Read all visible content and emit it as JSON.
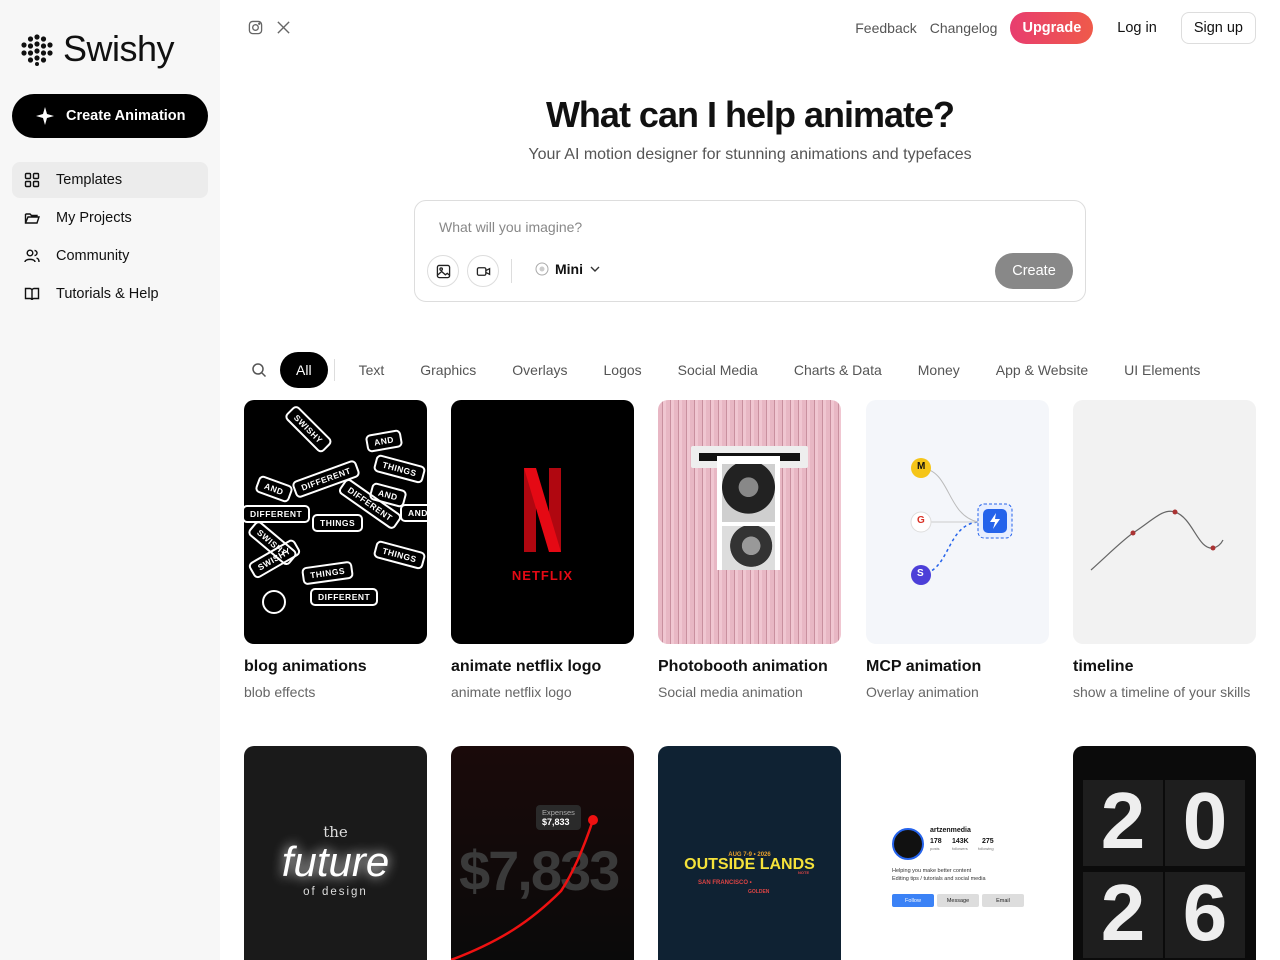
{
  "brand": {
    "name": "Swishy"
  },
  "sidebar": {
    "create_label": "Create Animation",
    "items": [
      {
        "label": "Templates",
        "icon": "grid-icon"
      },
      {
        "label": "My Projects",
        "icon": "folder-icon"
      },
      {
        "label": "Community",
        "icon": "users-icon"
      },
      {
        "label": "Tutorials & Help",
        "icon": "book-icon"
      }
    ]
  },
  "topbar": {
    "social": [
      "instagram-icon",
      "x-icon"
    ],
    "feedback": "Feedback",
    "changelog": "Changelog",
    "upgrade": "Upgrade",
    "login": "Log in",
    "signup": "Sign up"
  },
  "hero": {
    "title": "What can I help animate?",
    "subtitle": "Your AI motion designer for stunning animations and typefaces"
  },
  "prompt": {
    "placeholder": "What will you imagine?",
    "model": "Mini",
    "create": "Create"
  },
  "filters": [
    "All",
    "Text",
    "Graphics",
    "Overlays",
    "Logos",
    "Social Media",
    "Charts & Data",
    "Money",
    "App & Website",
    "UI Elements"
  ],
  "cards": [
    {
      "title": "blog animations",
      "subtitle": "blob effects"
    },
    {
      "title": "animate netflix logo",
      "subtitle": "animate netflix logo"
    },
    {
      "title": "Photobooth animation",
      "subtitle": "Social media animation"
    },
    {
      "title": "MCP animation",
      "subtitle": "Overlay animation"
    },
    {
      "title": "timeline",
      "subtitle": "show a timeline of your skills"
    }
  ],
  "thumb_text": {
    "blog_tags": [
      "SWISHY",
      "AND",
      "THINGS",
      "DIFFERENT",
      "AND",
      "DIFFERENT",
      "AND",
      "DIFFERENT",
      "THINGS",
      "AND",
      "SWISHY",
      "SWISHY",
      "THINGS",
      "THINGS",
      "DIFFERENT"
    ],
    "netflix_word": "NETFLIX",
    "mcp_badges": [
      "M",
      "G",
      "S"
    ],
    "future": {
      "the": "the",
      "future": "future",
      "of": "of design"
    },
    "expenses": {
      "label": "Expenses",
      "value": "$7,833",
      "big": "$7,833"
    },
    "outside_lands": {
      "date": "AUG 7-9 • 2026",
      "title": "OUTSIDE LANDS",
      "city": "SAN FRANCISCO •",
      "extra": "GOLDEN",
      "tiny": "NOTE"
    },
    "profile": {
      "name": "artzenmedia",
      "posts": "178",
      "posts_l": "posts",
      "followers": "143K",
      "followers_l": "followers",
      "following": "275",
      "following_l": "following",
      "bio1": "Helping you make better content",
      "bio2": "Editing tips / tutorials and social media",
      "follow": "Follow",
      "message": "Message",
      "email": "Email"
    },
    "year": [
      "2",
      "0",
      "2",
      "6"
    ]
  },
  "colors": {
    "upgrade_from": "#e83d6f",
    "upgrade_to": "#ef5a4a",
    "netflix": "#e50914",
    "accent_blue": "#2563eb"
  }
}
